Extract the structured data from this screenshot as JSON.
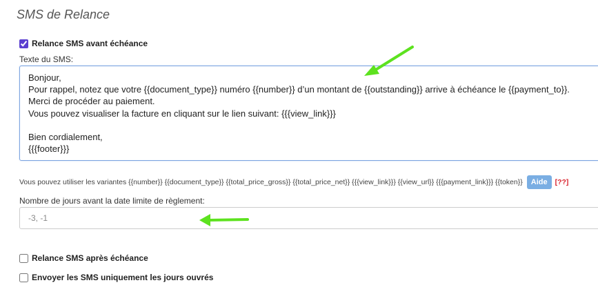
{
  "section": {
    "title": "SMS de Relance"
  },
  "before_due": {
    "label": "Relance SMS avant échéance",
    "checked": true
  },
  "sms_text": {
    "label": "Texte du SMS:",
    "value": "Bonjour,\nPour rappel, notez que votre {{document_type}} numéro {{number}} d’un montant de {{outstanding}} arrive à échéance le {{payment_to}}.\nMerci de procéder au paiement.\nVous pouvez visualiser la facture en cliquant sur le lien suivant: {{{view_link}}}\n\nBien cordialement,\n{{{footer}}}"
  },
  "variants": {
    "text": "Vous pouvez utiliser les variantes {{number}} {{document_type}} {{total_price_gross}} {{total_price_net}} {{{view_link}}} {{view_url}} {{{payment_link}}} {{token}}",
    "help_label": "Aide",
    "help_marker": "[??]"
  },
  "days_before": {
    "label": "Nombre de jours avant la date limite de règlement:",
    "placeholder": "-3, -1",
    "value": ""
  },
  "after_due": {
    "label": "Relance SMS après échéance",
    "checked": false
  },
  "working_days": {
    "label": "Envoyer les SMS uniquement les jours ouvrés",
    "checked": false
  },
  "colors": {
    "accent": "#5b3fd0",
    "help_button": "#7aaee3",
    "help_marker": "#d9232e",
    "annotation_arrow": "#5de21f"
  }
}
